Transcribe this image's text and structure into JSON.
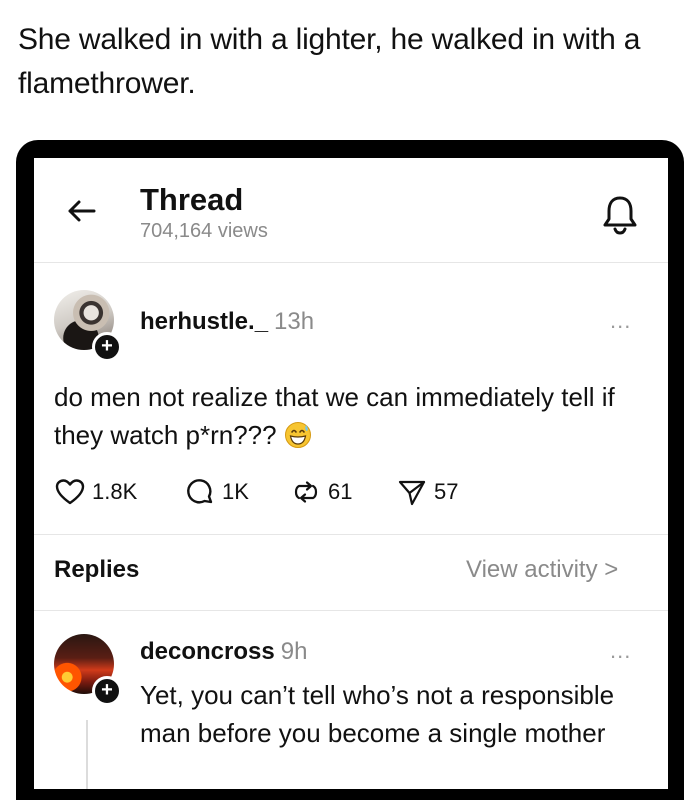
{
  "caption": "She walked in with a lighter, he walked in with a flamethrower.",
  "header": {
    "title": "Thread",
    "views": "704,164 views"
  },
  "post": {
    "username": "herhustle._",
    "time": "13h",
    "more": "...",
    "text": "do men not realize that we can immediately tell if they watch p*rn???",
    "emoji": "grinning-sweat-emoji",
    "stats": {
      "likes": "1.8K",
      "comments": "1K",
      "reposts": "61",
      "shares": "57"
    }
  },
  "replies": {
    "title": "Replies",
    "view_activity": "View activity >"
  },
  "reply": {
    "username": "deconcross",
    "time": "9h",
    "more": "...",
    "text": "Yet, you can’t tell who’s not a responsible man before you become a single mother"
  },
  "icons": {
    "back": "arrow-left-icon",
    "bell": "bell-icon",
    "like": "heart-icon",
    "comment": "comment-icon",
    "repost": "repost-icon",
    "share": "send-icon",
    "follow": "plus-icon"
  },
  "colors": {
    "text": "#111111",
    "muted": "#8a8a8a",
    "divider": "#e6e6e6",
    "frame": "#000000"
  }
}
